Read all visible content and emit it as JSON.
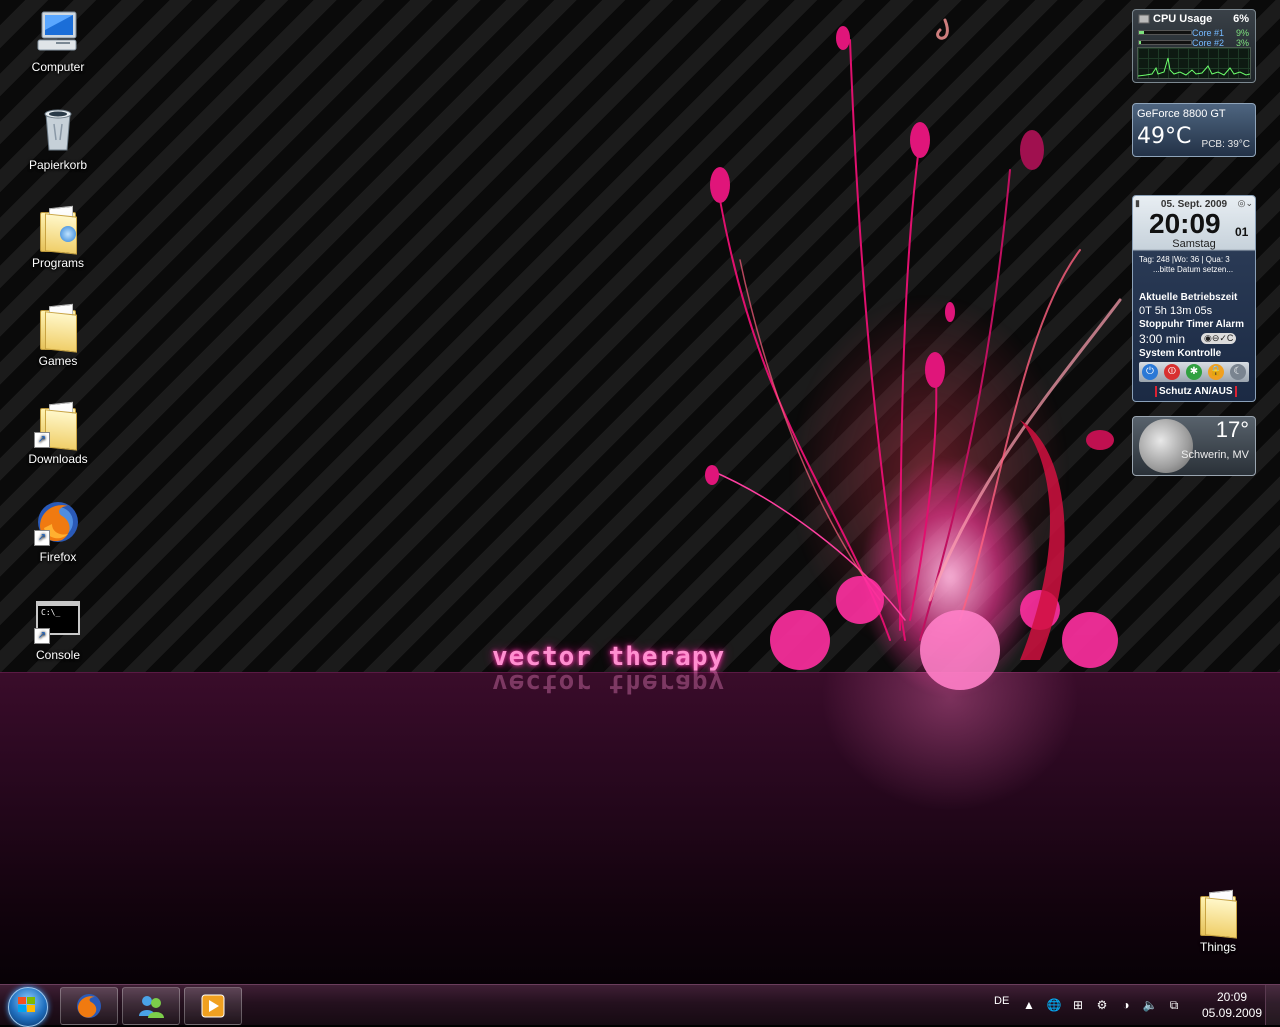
{
  "desktop": {
    "icons": [
      {
        "label": "Computer",
        "icon": "computer-icon"
      },
      {
        "label": "Papierkorb",
        "icon": "recycle-bin-icon"
      },
      {
        "label": "Programs",
        "icon": "folder-icon"
      },
      {
        "label": "Games",
        "icon": "folder-icon"
      },
      {
        "label": "Downloads",
        "icon": "folder-shortcut-icon"
      },
      {
        "label": "Firefox",
        "icon": "firefox-icon"
      },
      {
        "label": "Console",
        "icon": "console-icon"
      },
      {
        "label": "Things",
        "icon": "folder-icon"
      }
    ],
    "wallpaper_text": "vector therapy"
  },
  "gadgets": {
    "cpu": {
      "title": "CPU Usage",
      "total": "6%",
      "cores": [
        {
          "name": "Core #1",
          "value": "9%",
          "fraction": 0.09
        },
        {
          "name": "Core #2",
          "value": "3%",
          "fraction": 0.03
        }
      ]
    },
    "gpu": {
      "name": "GeForce 8800 GT",
      "temp": "49°C",
      "pcb": "PCB: 39°C"
    },
    "clock": {
      "date": "05. Sept. 2009",
      "time": "20:09",
      "seconds": "01",
      "day": "Samstag",
      "info": "Tag: 248 |Wo: 36 | Qua: 3",
      "info_note": "...bitte Datum setzen...",
      "uptime_label": "Aktuelle Betriebszeit",
      "uptime": "0T 5h 13m 05s",
      "stopwatch_label": "Stoppuhr Timer Alarm",
      "timer": "3:00 min",
      "system_label": "System Kontrolle",
      "protect_label": "Schutz AN/AUS"
    },
    "weather": {
      "temp": "17°",
      "location": "Schwerin, MV"
    }
  },
  "taskbar": {
    "pinned": [
      {
        "name": "firefox",
        "icon": "firefox-icon"
      },
      {
        "name": "messenger",
        "icon": "messenger-icon"
      },
      {
        "name": "media-player",
        "icon": "media-player-icon"
      }
    ],
    "tray": {
      "language": "DE",
      "time": "20:09",
      "date": "05.09.2009"
    }
  },
  "colors": {
    "accent": "#ff3fb0",
    "taskbar": "#24101e"
  }
}
